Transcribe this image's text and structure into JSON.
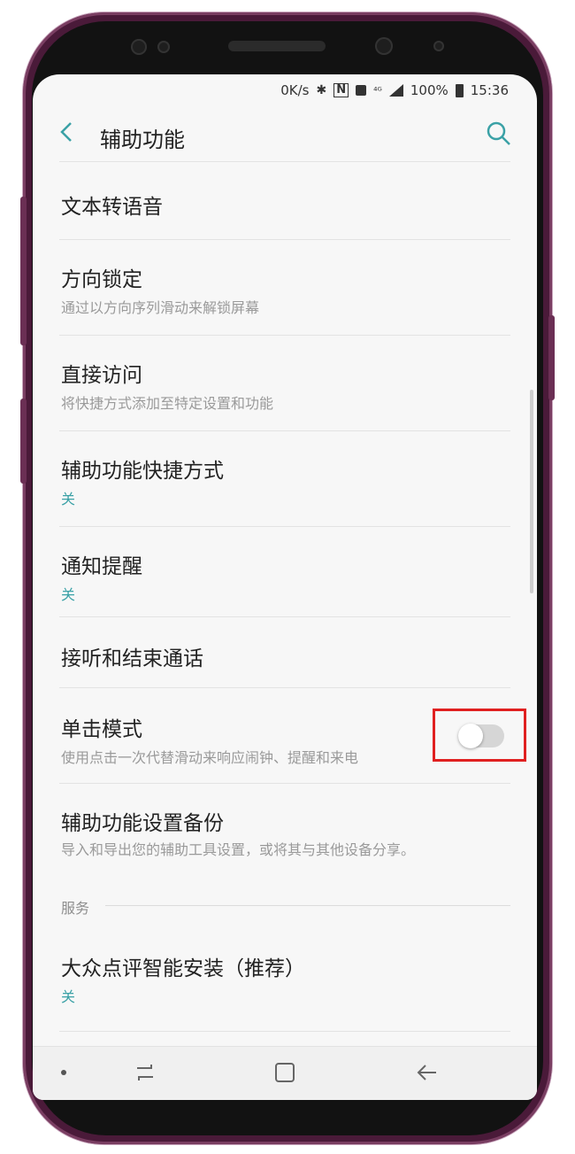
{
  "status_bar": {
    "net_speed": "0K/s",
    "battery": "100%",
    "time": "15:36",
    "icons": [
      "bluetooth-icon",
      "nfc-icon",
      "vibrate-icon",
      "wifi-icon",
      "signal-icon",
      "battery-icon"
    ]
  },
  "app_bar": {
    "title": "辅助功能",
    "back_icon": "chevron-left-icon",
    "search_icon": "search-icon"
  },
  "items": [
    {
      "title": "文本转语音",
      "subtitle": ""
    },
    {
      "title": "方向锁定",
      "subtitle": "通过以方向序列滑动来解锁屏幕"
    },
    {
      "title": "直接访问",
      "subtitle": "将快捷方式添加至特定设置和功能"
    },
    {
      "title": "辅助功能快捷方式",
      "subtitle": "关"
    },
    {
      "title": "通知提醒",
      "subtitle": "关"
    },
    {
      "title": "接听和结束通话",
      "subtitle": ""
    },
    {
      "title": "单击模式",
      "subtitle": "使用点击一次代替滑动来响应闹钟、提醒和来电",
      "toggle": false
    },
    {
      "title": "辅助功能设置备份",
      "subtitle": "导入和导出您的辅助工具设置，或将其与其他设备分享。"
    },
    {
      "title": "大众点评智能安装（推荐）",
      "subtitle": "关"
    }
  ],
  "section_header": "服务",
  "nav_bar": {
    "icons": [
      "nav-dot-icon",
      "recent-apps-icon",
      "home-icon",
      "back-icon"
    ]
  },
  "colors": {
    "accent": "#3aa1a6",
    "highlight_box": "#e02020",
    "phone_frame": "#4a1a39"
  }
}
